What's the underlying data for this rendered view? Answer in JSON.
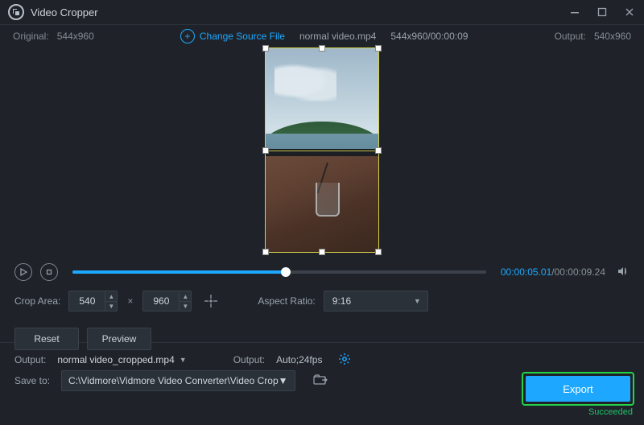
{
  "window": {
    "title": "Video Cropper"
  },
  "info": {
    "original_label": "Original:",
    "original_dims": "544x960",
    "change_source": "Change Source File",
    "filename": "normal video.mp4",
    "src_stat": "544x960/00:00:09",
    "output_label": "Output:",
    "output_dims": "540x960"
  },
  "transport": {
    "current": "00:00:05.01",
    "total": "00:00:09.24"
  },
  "crop": {
    "label": "Crop Area:",
    "w": "540",
    "h": "960",
    "aspect_label": "Aspect Ratio:",
    "aspect_value": "9:16",
    "reset": "Reset",
    "preview": "Preview"
  },
  "output": {
    "file_label": "Output:",
    "file_value": "normal video_cropped.mp4",
    "fmt_label": "Output:",
    "fmt_value": "Auto;24fps",
    "save_label": "Save to:",
    "save_path": "C:\\Vidmore\\Vidmore Video Converter\\Video Crop"
  },
  "export": {
    "button": "Export",
    "status": "Succeeded"
  }
}
